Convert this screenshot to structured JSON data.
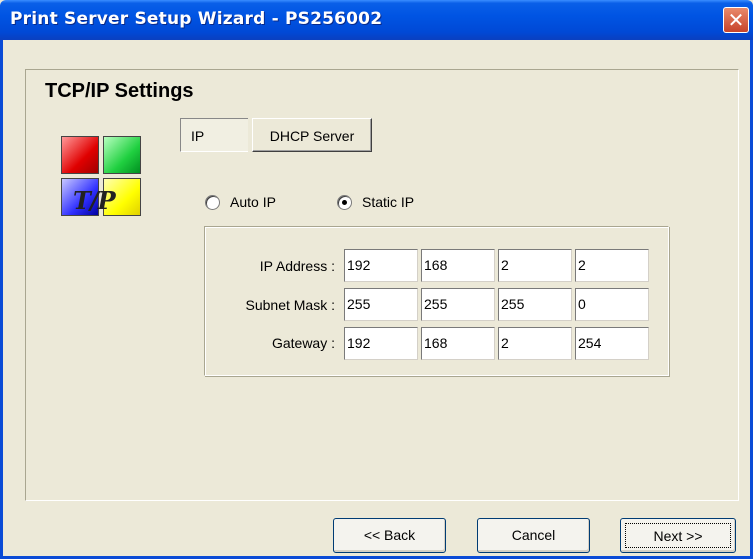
{
  "window": {
    "title": "Print Server Setup Wizard - PS256002",
    "close_glyph": "✕"
  },
  "page": {
    "heading": "TCP/IP Settings"
  },
  "logo": {
    "text": "T/P",
    "colors": [
      "#e00000",
      "#20d040",
      "#3030ff",
      "#ffff00"
    ]
  },
  "tabs": [
    {
      "label": "IP",
      "active": true
    },
    {
      "label": "DHCP Server",
      "active": false
    }
  ],
  "radios": [
    {
      "label": "Auto IP",
      "checked": false
    },
    {
      "label": "Static IP",
      "checked": true
    }
  ],
  "fields": {
    "ip_address": {
      "label": "IP Address :",
      "octets": [
        "192",
        "168",
        "2",
        "2"
      ]
    },
    "subnet_mask": {
      "label": "Subnet Mask :",
      "octets": [
        "255",
        "255",
        "255",
        "0"
      ]
    },
    "gateway": {
      "label": "Gateway :",
      "octets": [
        "192",
        "168",
        "2",
        "254"
      ]
    }
  },
  "buttons": {
    "back": "<< Back",
    "cancel": "Cancel",
    "next": "Next >>"
  }
}
